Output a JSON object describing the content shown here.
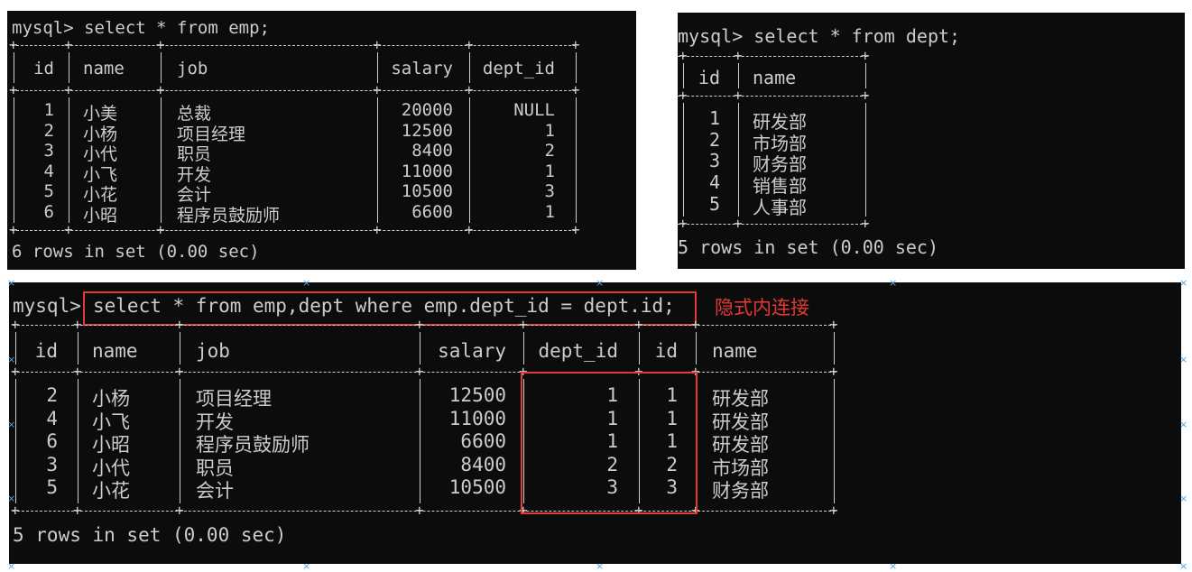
{
  "colors": {
    "terminal_bg": "#0c0c0c",
    "text": "#cccccc",
    "highlight": "#e53935"
  },
  "emp": {
    "command": "mysql> select * from emp;",
    "headers": [
      "id",
      "name",
      "job",
      "salary",
      "dept_id"
    ],
    "rows": [
      [
        "1",
        "小美",
        "总裁",
        "20000",
        "NULL"
      ],
      [
        "2",
        "小杨",
        "项目经理",
        "12500",
        "1"
      ],
      [
        "3",
        "小代",
        "职员",
        "8400",
        "2"
      ],
      [
        "4",
        "小飞",
        "开发",
        "11000",
        "1"
      ],
      [
        "5",
        "小花",
        "会计",
        "10500",
        "3"
      ],
      [
        "6",
        "小昭",
        "程序员鼓励师",
        "6600",
        "1"
      ]
    ],
    "footer": "6 rows in set (0.00 sec)"
  },
  "dept": {
    "command": "mysql> select * from dept;",
    "headers": [
      "id",
      "name"
    ],
    "rows": [
      [
        "1",
        "研发部"
      ],
      [
        "2",
        "市场部"
      ],
      [
        "3",
        "财务部"
      ],
      [
        "4",
        "销售部"
      ],
      [
        "5",
        "人事部"
      ]
    ],
    "footer": "5 rows in set (0.00 sec)"
  },
  "join": {
    "prompt": "mysql>",
    "command": "select * from emp,dept where emp.dept_id = dept.id;",
    "annotation": "隐式内连接",
    "headers": [
      "id",
      "name",
      "job",
      "salary",
      "dept_id",
      "id",
      "name"
    ],
    "rows": [
      [
        "2",
        "小杨",
        "项目经理",
        "12500",
        "1",
        "1",
        "研发部"
      ],
      [
        "4",
        "小飞",
        "开发",
        "11000",
        "1",
        "1",
        "研发部"
      ],
      [
        "6",
        "小昭",
        "程序员鼓励师",
        "6600",
        "1",
        "1",
        "研发部"
      ],
      [
        "3",
        "小代",
        "职员",
        "8400",
        "2",
        "2",
        "市场部"
      ],
      [
        "5",
        "小花",
        "会计",
        "10500",
        "3",
        "3",
        "财务部"
      ]
    ],
    "footer": "5 rows in set (0.00 sec)"
  }
}
